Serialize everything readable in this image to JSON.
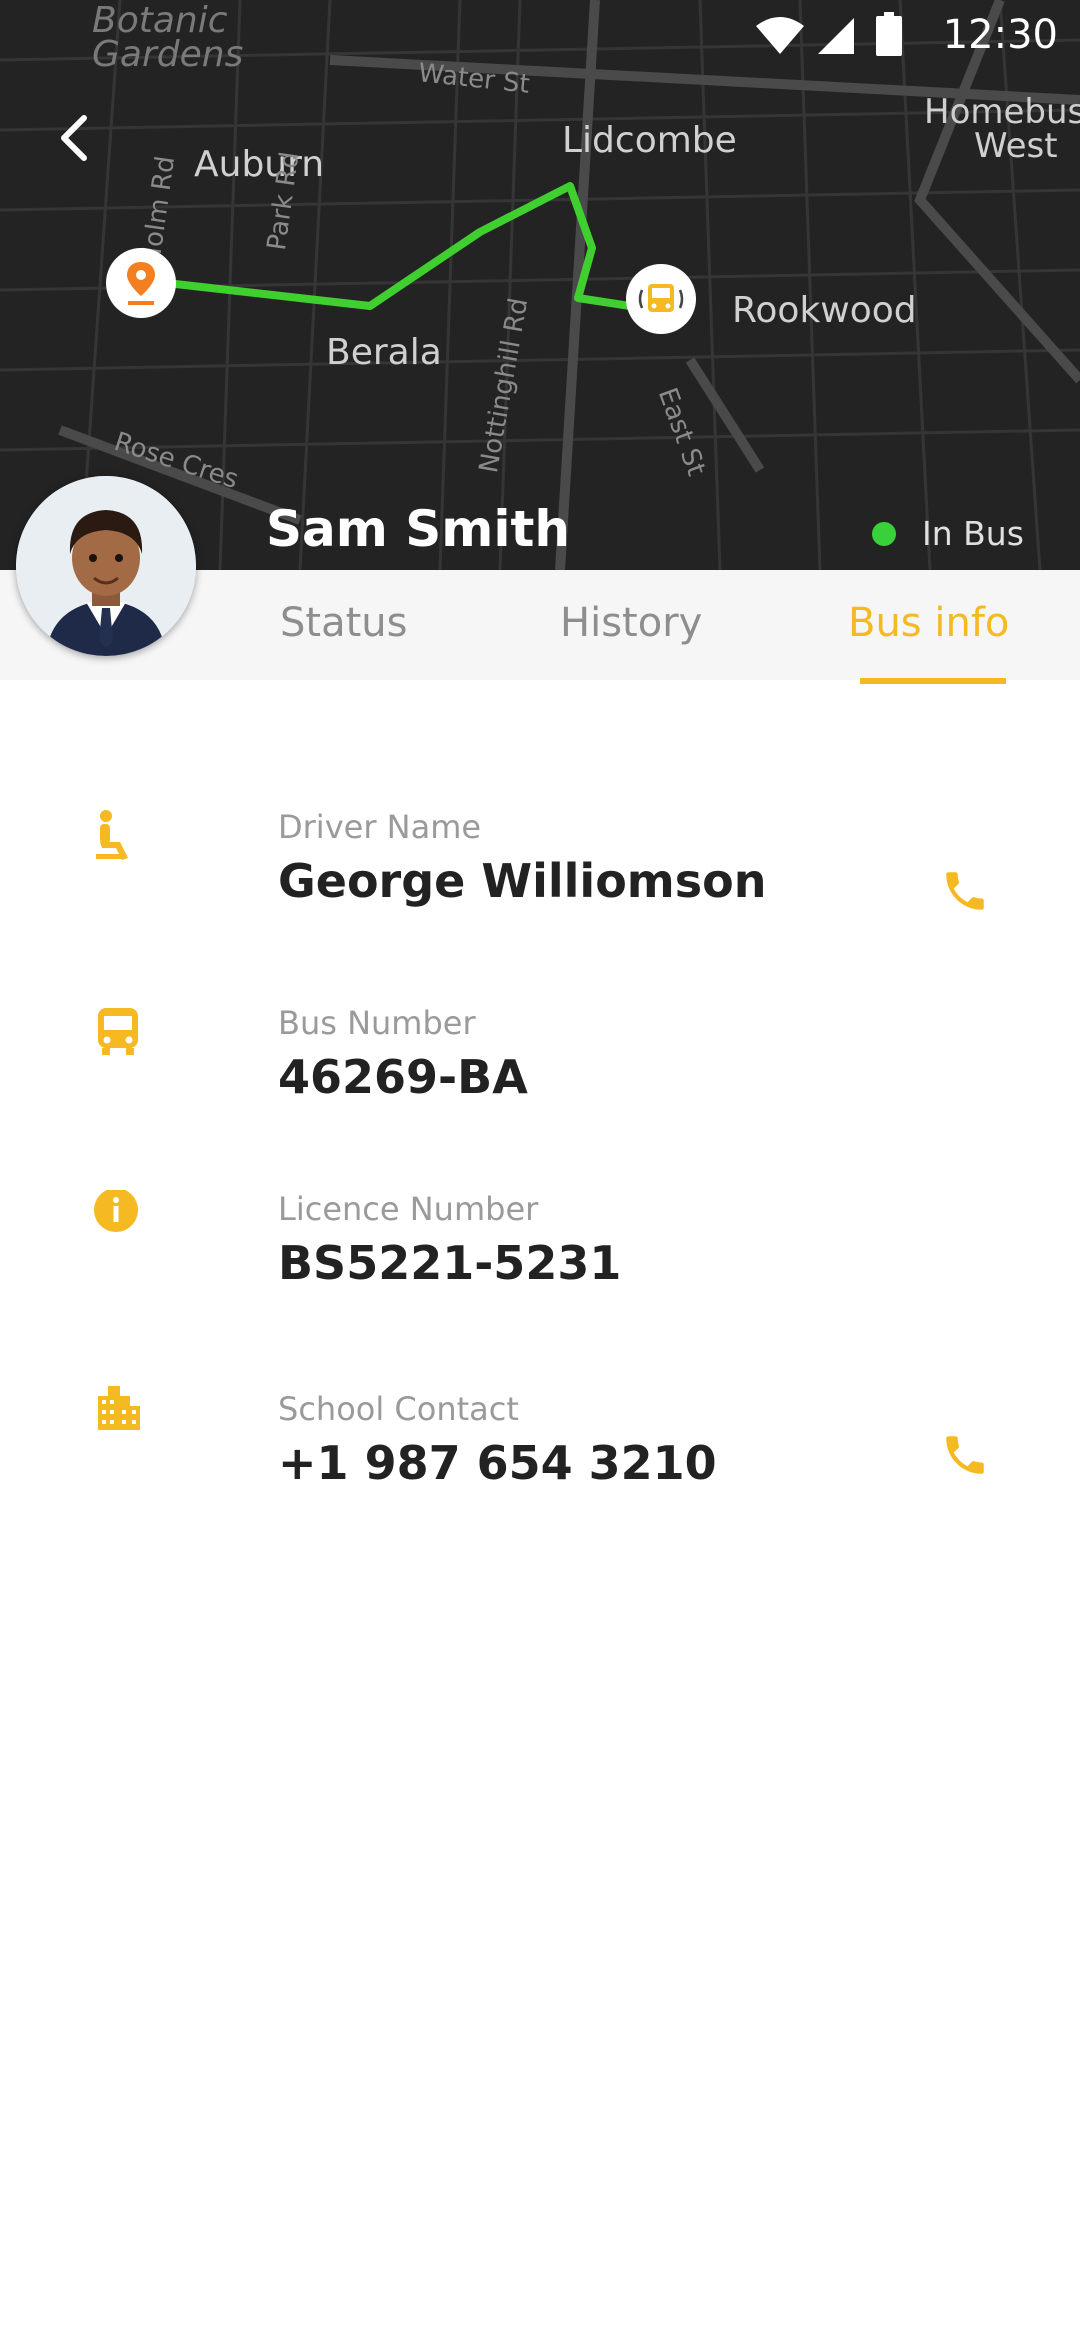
{
  "status_bar": {
    "time": "12:30"
  },
  "map": {
    "labels": {
      "botanic_line1": "Botanic",
      "botanic_line2": "Gardens",
      "water_st": "Water St",
      "homebush_line1": "Homebush",
      "homebush_line2": "West",
      "lidcombe": "Lidcombe",
      "auburn": "Auburn",
      "park_rd": "Park Rd",
      "holm_rd": "Holm Rd",
      "rookwood": "Rookwood",
      "berala": "Berala",
      "nottinghill_rd": "Nottinghill Rd",
      "east_st": "East St",
      "rose_cres": "Rose Cres"
    },
    "route_color": "#3fcf2f"
  },
  "student": {
    "name": "Sam Smith",
    "status": "In Bus",
    "status_color": "#39d13a"
  },
  "tabs": [
    {
      "label": "Status"
    },
    {
      "label": "History"
    },
    {
      "label": "Bus info"
    }
  ],
  "active_tab": "Bus info",
  "accent_color": "#f5b921",
  "bus_info": [
    {
      "icon": "seat-icon",
      "label": "Driver Name",
      "value": "George Williomson",
      "has_call": true
    },
    {
      "icon": "bus-icon",
      "label": "Bus Number",
      "value": "46269-BA",
      "has_call": false
    },
    {
      "icon": "info-icon",
      "label": "Licence Number",
      "value": "BS5221-5231",
      "has_call": false
    },
    {
      "icon": "building-icon",
      "label": "School Contact",
      "value": "+1 987 654 3210",
      "has_call": true
    }
  ]
}
